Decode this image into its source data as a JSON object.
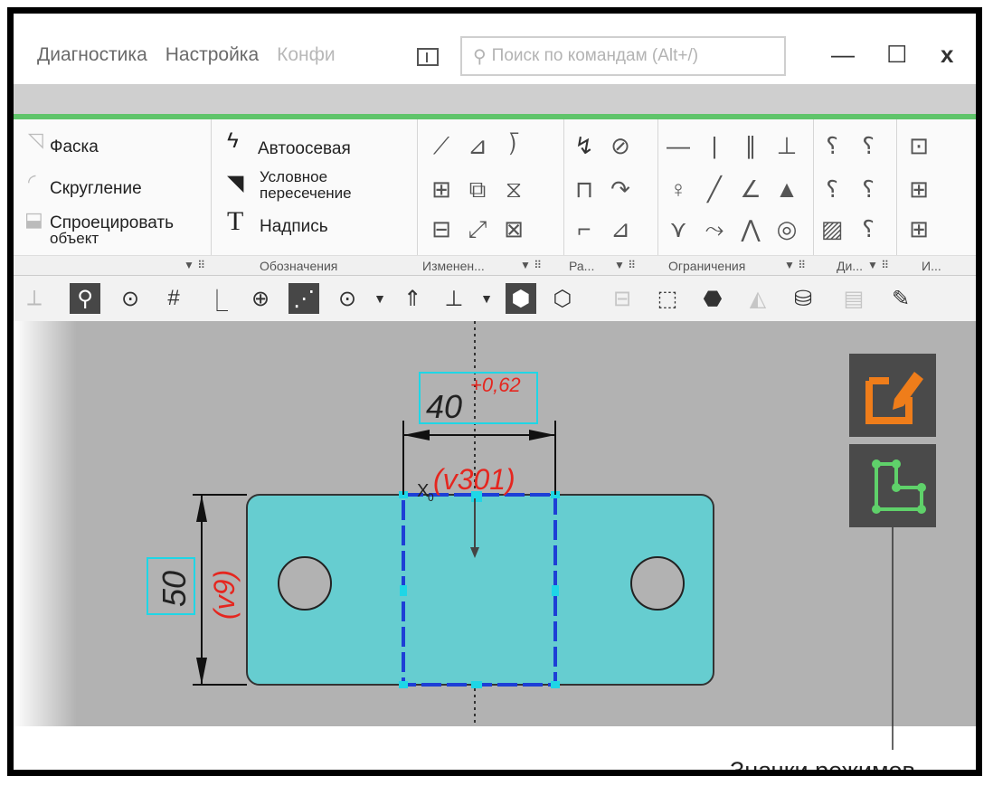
{
  "menu": {
    "items": [
      "Диагностика",
      "Настройка",
      "Конфи"
    ],
    "search_placeholder": "Поиск по командам (Alt+/)",
    "minimize": "—",
    "maximize": "☐",
    "close": "x"
  },
  "ribbon": {
    "left_items": [
      "Фаска",
      "Скругление",
      "Спроецировать",
      "объект"
    ],
    "notation_items": [
      "Автоосевая",
      "Условное",
      "пересечение",
      "Надпись"
    ],
    "group_labels": [
      "Обозначения",
      "Изменен...",
      "Ра...",
      "Ограничения",
      "Ди...",
      "И..."
    ]
  },
  "drawing": {
    "dim_width": "40",
    "tolerance": "+0,62",
    "variable_width": "(v301)",
    "dim_height": "50",
    "variable_height": "(v9)",
    "origin_label": "X",
    "origin_sub": "0"
  },
  "caption": "Значки режимов",
  "colors": {
    "part_fill": "#66cdd0",
    "selection": "#1d3fd6",
    "variable_red": "#e5261f",
    "edit_mode_orange": "#ef7d1a",
    "mode_green": "#5fd16a",
    "accent_line": "#5fc46a"
  },
  "icons": [
    "edit-sketch-mode-icon",
    "parametric-mode-icon"
  ]
}
